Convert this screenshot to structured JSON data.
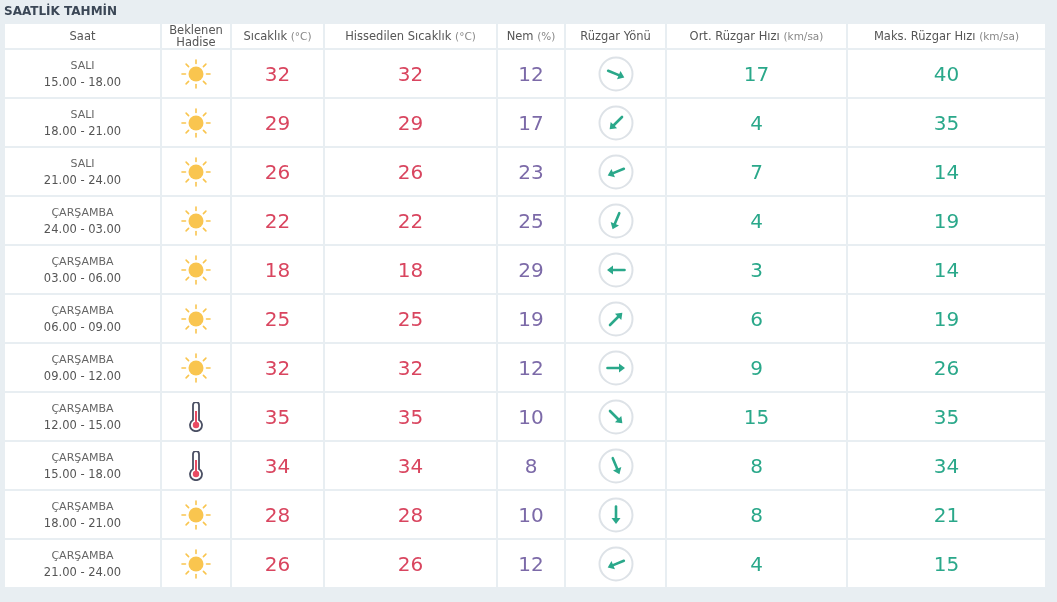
{
  "title": "SAATLİK TAHMİN",
  "columns": [
    {
      "label": "Saat"
    },
    {
      "label": "Beklenen Hadise"
    },
    {
      "label": "Sıcaklık",
      "unit": "(°C)"
    },
    {
      "label": "Hissedilen Sıcaklık",
      "unit": "(°C)"
    },
    {
      "label": "Nem",
      "unit": "(%)"
    },
    {
      "label": "Rüzgar Yönü"
    },
    {
      "label": "Ort. Rüzgar Hızı",
      "unit": "(km/sa)"
    },
    {
      "label": "Maks. Rüzgar Hızı",
      "unit": "(km/sa)"
    }
  ],
  "rows": [
    {
      "day": "SALI",
      "time": "15.00 - 18.00",
      "weather": {
        "kind": "sunny"
      },
      "temp": "32",
      "feels": "32",
      "humidity": "12",
      "wind_direction": {
        "kind": "ese"
      },
      "avg_wind": "17",
      "max_wind": "40"
    },
    {
      "day": "SALI",
      "time": "18.00 - 21.00",
      "weather": {
        "kind": "sunny"
      },
      "temp": "29",
      "feels": "29",
      "humidity": "17",
      "wind_direction": {
        "kind": "sw"
      },
      "avg_wind": "4",
      "max_wind": "35"
    },
    {
      "day": "SALI",
      "time": "21.00 - 24.00",
      "weather": {
        "kind": "sunny"
      },
      "temp": "26",
      "feels": "26",
      "humidity": "23",
      "wind_direction": {
        "kind": "wsw"
      },
      "avg_wind": "7",
      "max_wind": "14"
    },
    {
      "day": "ÇARŞAMBA",
      "time": "24.00 - 03.00",
      "weather": {
        "kind": "sunny"
      },
      "temp": "22",
      "feels": "22",
      "humidity": "25",
      "wind_direction": {
        "kind": "ssw"
      },
      "avg_wind": "4",
      "max_wind": "19"
    },
    {
      "day": "ÇARŞAMBA",
      "time": "03.00 - 06.00",
      "weather": {
        "kind": "sunny"
      },
      "temp": "18",
      "feels": "18",
      "humidity": "29",
      "wind_direction": {
        "kind": "w"
      },
      "avg_wind": "3",
      "max_wind": "14"
    },
    {
      "day": "ÇARŞAMBA",
      "time": "06.00 - 09.00",
      "weather": {
        "kind": "sunny"
      },
      "temp": "25",
      "feels": "25",
      "humidity": "19",
      "wind_direction": {
        "kind": "ne"
      },
      "avg_wind": "6",
      "max_wind": "19"
    },
    {
      "day": "ÇARŞAMBA",
      "time": "09.00 - 12.00",
      "weather": {
        "kind": "sunny"
      },
      "temp": "32",
      "feels": "32",
      "humidity": "12",
      "wind_direction": {
        "kind": "e"
      },
      "avg_wind": "9",
      "max_wind": "26"
    },
    {
      "day": "ÇARŞAMBA",
      "time": "12.00 - 15.00",
      "weather": {
        "kind": "hot"
      },
      "temp": "35",
      "feels": "35",
      "humidity": "10",
      "wind_direction": {
        "kind": "se"
      },
      "avg_wind": "15",
      "max_wind": "35"
    },
    {
      "day": "ÇARŞAMBA",
      "time": "15.00 - 18.00",
      "weather": {
        "kind": "hot"
      },
      "temp": "34",
      "feels": "34",
      "humidity": "8",
      "wind_direction": {
        "kind": "sse"
      },
      "avg_wind": "8",
      "max_wind": "34"
    },
    {
      "day": "ÇARŞAMBA",
      "time": "18.00 - 21.00",
      "weather": {
        "kind": "sunny"
      },
      "temp": "28",
      "feels": "28",
      "humidity": "10",
      "wind_direction": {
        "kind": "s"
      },
      "avg_wind": "8",
      "max_wind": "21"
    },
    {
      "day": "ÇARŞAMBA",
      "time": "21.00 - 24.00",
      "weather": {
        "kind": "sunny"
      },
      "temp": "26",
      "feels": "26",
      "humidity": "12",
      "wind_direction": {
        "kind": "wsw"
      },
      "avg_wind": "4",
      "max_wind": "15"
    }
  ]
}
